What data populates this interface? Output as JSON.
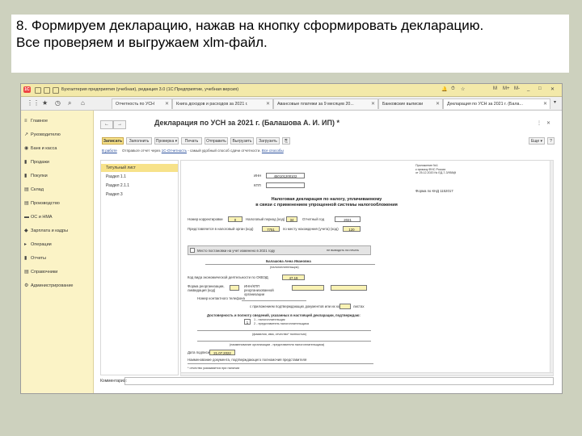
{
  "caption": {
    "line1": "8. Формируем декларацию, нажав на кнопку сформировать декларацию.",
    "line2": "Все проверяем и выгружаем xlm-файл."
  },
  "app": {
    "title": "Бухгалтерия предприятия (учебная), редакция 3.0  (1С:Предприятие, учебная версия)",
    "logo_text": "1С",
    "window_controls": [
      "M",
      "M+",
      "M-",
      "_",
      "□",
      "✕"
    ]
  },
  "tabs": [
    {
      "label": "Начальная страница"
    },
    {
      "label": "Отчетность по УСН"
    },
    {
      "label": "Книга доходов и расходов за 2021 г."
    },
    {
      "label": "Авансовые платежи за 9 месяцев 20..."
    },
    {
      "label": "Банковские выписки"
    },
    {
      "label": "Декларация по УСН за 2021 г. (Бала..."
    }
  ],
  "sidebar": {
    "items": [
      {
        "label": "Главное",
        "icon": "≡"
      },
      {
        "label": "Руководителю",
        "icon": "↗"
      },
      {
        "label": "Банк и касса",
        "icon": "◉"
      },
      {
        "label": "Продажи",
        "icon": "▮"
      },
      {
        "label": "Покупки",
        "icon": "▮"
      },
      {
        "label": "Склад",
        "icon": "▤"
      },
      {
        "label": "Производство",
        "icon": "▤"
      },
      {
        "label": "ОС и НМА",
        "icon": "▬"
      },
      {
        "label": "Зарплата и кадры",
        "icon": "◆"
      },
      {
        "label": "Операции",
        "icon": "▸"
      },
      {
        "label": "Отчеты",
        "icon": "▮"
      },
      {
        "label": "Справочники",
        "icon": "▤"
      },
      {
        "label": "Администрирование",
        "icon": "⚙"
      }
    ]
  },
  "document": {
    "title": "Декларация по УСН за 2021 г. (Балашова А. И. ИП) *",
    "toolbar": {
      "write": "Записать",
      "fill": "Заполнить",
      "check": "Проверка ▾",
      "print": "Печать",
      "send": "Отправить",
      "export": "Выгрузить",
      "upload": "Загрузить",
      "more": "Еще ▾",
      "help": "?"
    },
    "status": {
      "work": "В работе",
      "text": "Отправьте отчет через",
      "service": "1С-Отчетность",
      "middle": "- самый удобный способ сдачи отчетности.",
      "all_methods": "Все способы"
    },
    "sections": [
      "Титульный лист",
      "Раздел 1.1",
      "Раздел 2.1.1",
      "Раздел 3"
    ],
    "comment_label": "Комментарий:"
  },
  "form": {
    "appendix": "Приложение №1\nк приказу ФНС России\nот 25.12.2020 № ЕД-7-3/958@",
    "inn_label": "ИНН",
    "inn": "450101200102",
    "kpp_label": "КПП",
    "knd": "Форма по КНД 1152017",
    "heading1": "Налоговая декларация по налогу, уплачиваемому",
    "heading2": "в связи с применением упрощенной системы налогообложения",
    "corr_label": "Номер корректировки",
    "corr": "0",
    "period_label": "Налоговый период (код)",
    "period": "34",
    "year_label": "Отчетный год",
    "year": "2021",
    "organ_label": "Представляется в налоговый орган (код)",
    "organ": "7751",
    "place_label": "по месту нахождения (учета) (код)",
    "place": "120",
    "closed_label": "Место постановки на учет изменено в 2021 году",
    "closed_right": "не выводить на печать",
    "person": "Балашова Анна Ивановна",
    "person_sub": "(налогоплательщик)",
    "okved_label": "Код вида экономической деятельности по ОКВЭД",
    "okved": "47.19",
    "reorg_label": "Форма реорганизации, ликвидация (код)",
    "reorg_inn": "ИНН/КПП реорганизованной организации",
    "phone_label": "Номер контактного телефона",
    "pages_text": "с приложением подтверждающих документов или их копий на",
    "pages_suffix": "листах",
    "confirm_heading": "Достоверность и полноту сведений, указанных в настоящей декларации, подтверждаю:",
    "signer_code": "1",
    "signer_opts": "1 - налогоплательщик\n2 - представитель налогоплательщика",
    "fio_caption": "(фамилия, имя, отчество* полностью)",
    "org_caption": "(наименование организации - представителя налогоплательщика)",
    "date_label": "Дата подписи",
    "date": "21.07.2022",
    "doc_label": "Наименование документа, подтверждающего полномочия представителя",
    "footnote": "* отчество указывается при наличии"
  },
  "colors": {
    "slide_bg": "#cdd1be",
    "accent": "#f7e28a",
    "titlebar": "#f3e9a9",
    "sidebar": "#fbf3c6"
  }
}
